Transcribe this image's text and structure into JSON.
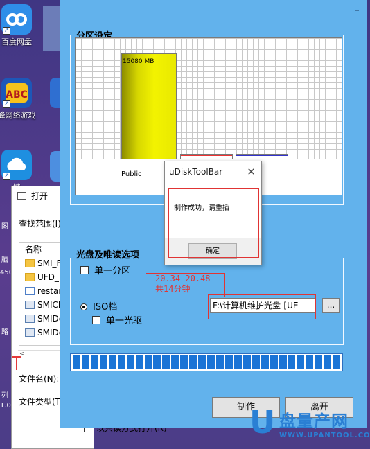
{
  "desktop": {
    "icons": [
      {
        "label": "百度网盘",
        "icon": "baidu-cloud-icon"
      },
      {
        "label": "蜂网络游戏",
        "icon": "abc-game-icon"
      },
      {
        "label": "城",
        "icon": "cloud-icon"
      }
    ],
    "partial_labels": [
      "图",
      "脑",
      "450",
      "路",
      "1.0",
      "列",
      "机"
    ]
  },
  "open_dialog": {
    "title": "打开",
    "look_in_label": "查找范围(I)",
    "name_column": "名称",
    "files": [
      {
        "name": "SMI_Fi",
        "kind": "folder"
      },
      {
        "name": "UFD_D",
        "kind": "folder"
      },
      {
        "name": "restart",
        "kind": "file"
      },
      {
        "name": "SMICle",
        "kind": "app"
      },
      {
        "name": "SMIDe",
        "kind": "app"
      },
      {
        "name": "SMIDe",
        "kind": "app"
      }
    ],
    "filename_label": "文件名(N):",
    "filetype_label": "文件类型(T",
    "readonly_label": "以只读方式打开(R)"
  },
  "main": {
    "partition_group_title": "分区设定",
    "partition_size": "15080 MB",
    "partition_name": "Public",
    "cd_group_title": "光盘及唯读选项",
    "single_partition_label": "单一分区",
    "iso_label": "ISO档",
    "single_cd_label": "单一光驱",
    "iso_path": "F:\\计算机维护光盘-[UE",
    "browse_label": "...",
    "annotation_line1": "20.34-20.48",
    "annotation_line2": "共14分钟",
    "make_button": "制作",
    "exit_button": "离开",
    "progress_value": 1.0,
    "progress_segments": 30,
    "colors": {
      "dialog_bg": "#62b2ec",
      "progress": "#1a74d6",
      "annotation": "#e03434",
      "bar": "#e8e800"
    }
  },
  "msgbox": {
    "title": "uDiskToolBar",
    "message": "制作成功，请重插",
    "ok_button": "确定"
  },
  "watermark": {
    "brand": "盘量产网",
    "url": "WWW.UPANTOOL.COM"
  }
}
